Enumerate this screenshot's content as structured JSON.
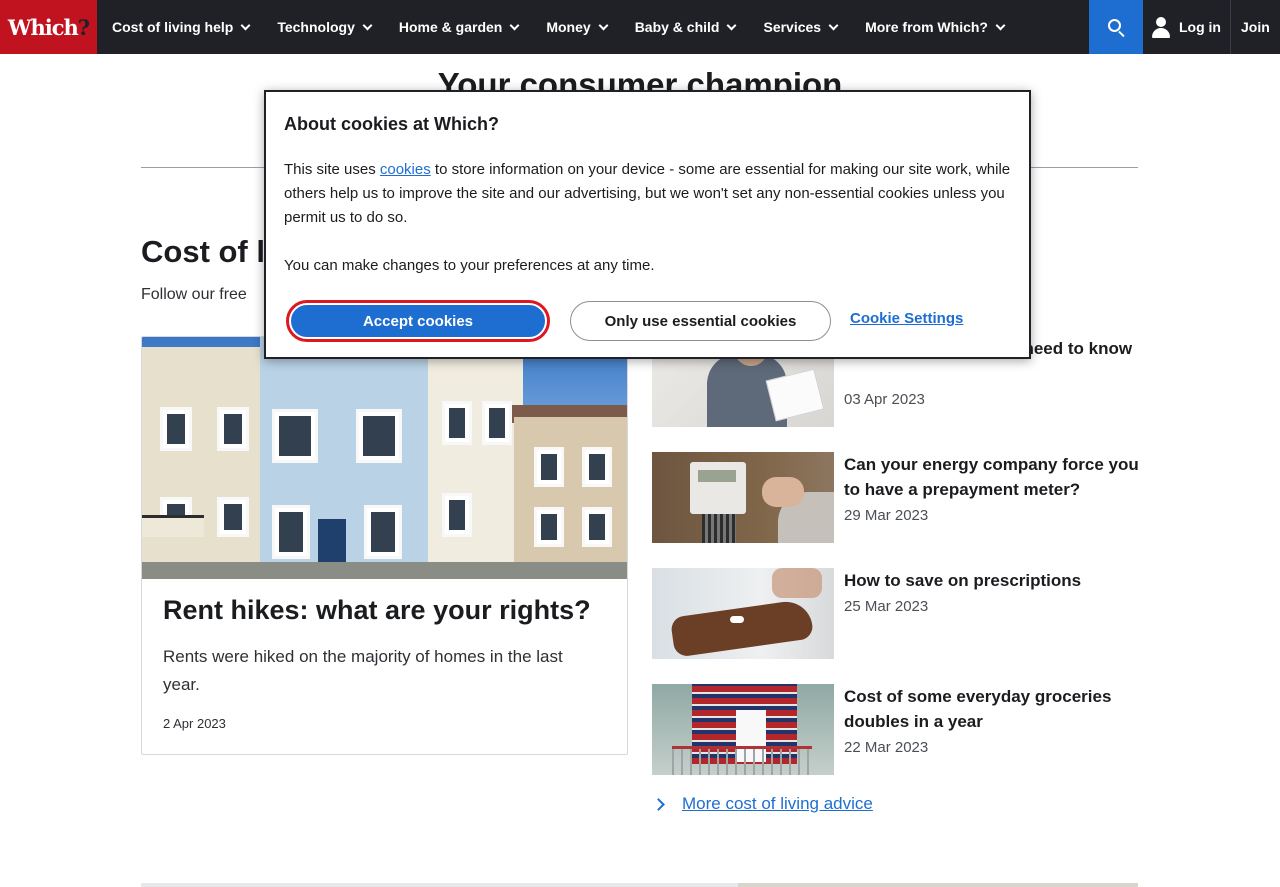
{
  "brand": {
    "logo_text": "Which",
    "logo_q": "?"
  },
  "nav": {
    "items": [
      {
        "label": "Cost of living help"
      },
      {
        "label": "Technology"
      },
      {
        "label": "Home & garden"
      },
      {
        "label": "Money"
      },
      {
        "label": "Baby & child"
      },
      {
        "label": "Services"
      },
      {
        "label": "More from Which?"
      }
    ],
    "login_label": "Log in",
    "join_label": "Join"
  },
  "page": {
    "hero_title": "Your consumer champion",
    "section_title": "Cost of l",
    "section_sub": "Follow our free"
  },
  "feature": {
    "title": "Rent hikes: what are your rights?",
    "desc": "Rents were hiked on the majority of homes in the last year.",
    "date": "2 Apr 2023"
  },
  "articles": [
    {
      "title": "pport: everything you need to know",
      "date": "03 Apr 2023"
    },
    {
      "title": "Can your energy company force you to have a prepayment meter?",
      "date": "29 Mar 2023"
    },
    {
      "title": "How to save on prescriptions",
      "date": "25 Mar 2023"
    },
    {
      "title": "Cost of some everyday groceries doubles in a year",
      "date": "22 Mar 2023"
    }
  ],
  "more_link": "More cost of living advice",
  "cookie_modal": {
    "title": "About cookies at Which?",
    "text_before": "This site uses ",
    "link": "cookies",
    "text_after": " to store information on your device - some are essential for making our site work, while others help us to improve the site and our advertising, but we won't set any non-essential cookies unless you permit us to do so.",
    "text2": "You can make changes to your preferences at any time.",
    "accept_label": "Accept cookies",
    "essential_label": "Only use essential cookies",
    "settings_label": "Cookie Settings"
  },
  "colors": {
    "brand_red": "#c1121f",
    "nav_bg": "#1f2126",
    "accent_blue": "#1e6ed2"
  },
  "icons": [
    "search-icon",
    "user-icon",
    "chevron-down-icon",
    "chevron-right-icon"
  ]
}
